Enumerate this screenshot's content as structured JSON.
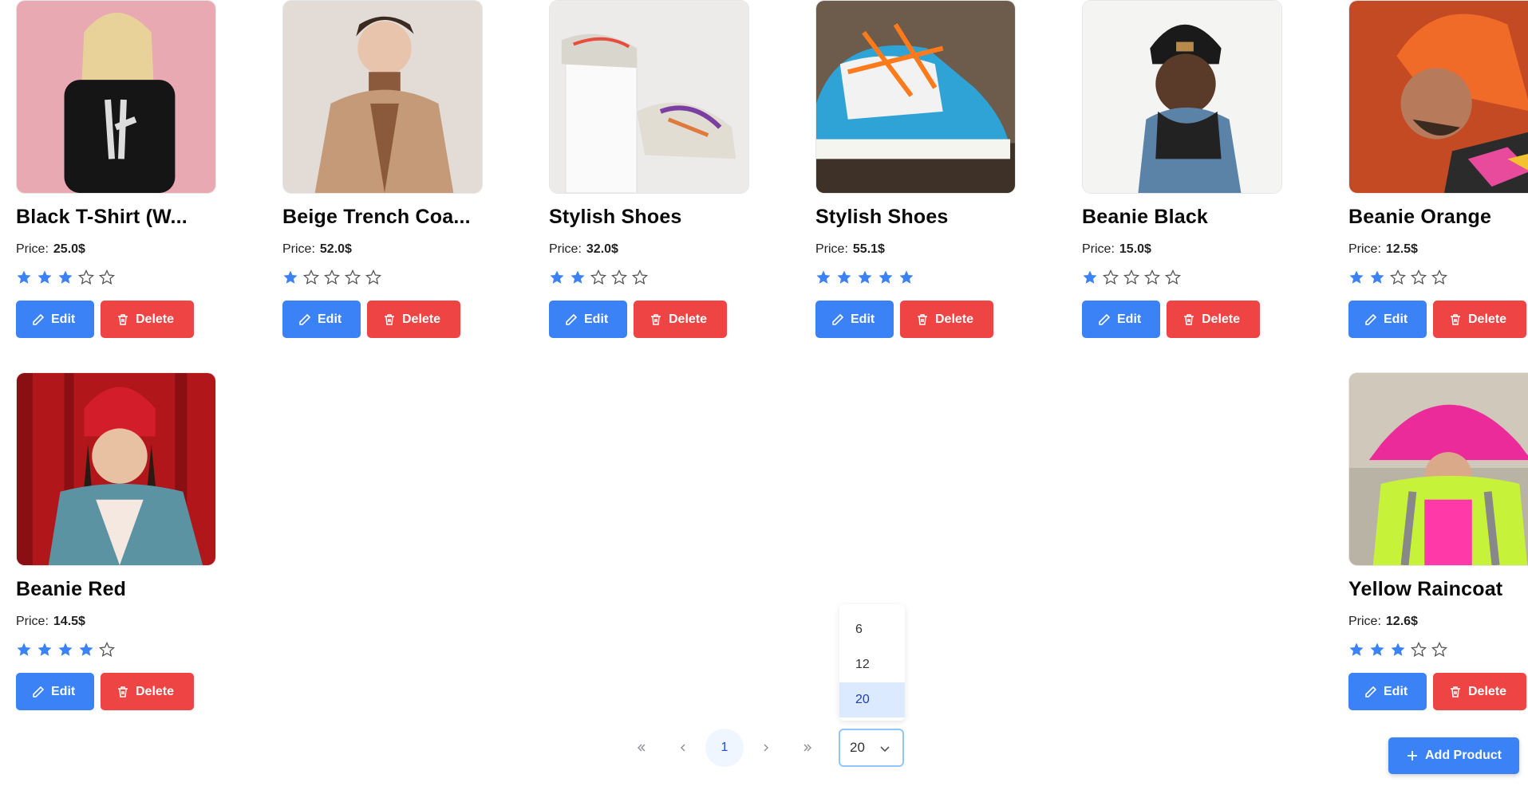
{
  "products": [
    {
      "title": "Black T-Shirt (W...",
      "price_label": "Price:",
      "price": "25.0$",
      "rating": 3,
      "edit_label": "Edit",
      "delete_label": "Delete",
      "image": "woman-black-tshirt-photo"
    },
    {
      "title": "Beige Trench Coa...",
      "price_label": "Price:",
      "price": "52.0$",
      "rating": 1,
      "edit_label": "Edit",
      "delete_label": "Delete",
      "image": "man-beige-coat-photo"
    },
    {
      "title": "Stylish Shoes",
      "price_label": "Price:",
      "price": "32.0$",
      "rating": 2,
      "edit_label": "Edit",
      "delete_label": "Delete",
      "image": "white-sneakers-photo"
    },
    {
      "title": "Stylish Shoes",
      "price_label": "Price:",
      "price": "55.1$",
      "rating": 5,
      "edit_label": "Edit",
      "delete_label": "Delete",
      "image": "blue-sneaker-photo"
    },
    {
      "title": "Beanie Black",
      "price_label": "Price:",
      "price": "15.0$",
      "rating": 1,
      "edit_label": "Edit",
      "delete_label": "Delete",
      "image": "man-black-beanie-photo"
    },
    {
      "title": "Beanie Orange",
      "price_label": "Price:",
      "price": "12.5$",
      "rating": 2,
      "edit_label": "Edit",
      "delete_label": "Delete",
      "image": "man-orange-beanie-photo"
    },
    {
      "title": "Beanie Red",
      "price_label": "Price:",
      "price": "14.5$",
      "rating": 4,
      "edit_label": "Edit",
      "delete_label": "Delete",
      "image": "woman-red-beanie-photo"
    },
    {
      "title": "Yellow Raincoat",
      "price_label": "Price:",
      "price": "12.6$",
      "rating": 3,
      "edit_label": "Edit",
      "delete_label": "Delete",
      "image": "pink-hat-raincoat-photo"
    }
  ],
  "pagination": {
    "current_page": "1",
    "page_size": "20",
    "page_size_options": [
      "6",
      "12",
      "20"
    ],
    "selected_option": "20"
  },
  "actions": {
    "add_product_label": "Add Product"
  },
  "colors": {
    "primary": "#3b82f6",
    "danger": "#ef4444",
    "star": "#3b82f6"
  }
}
